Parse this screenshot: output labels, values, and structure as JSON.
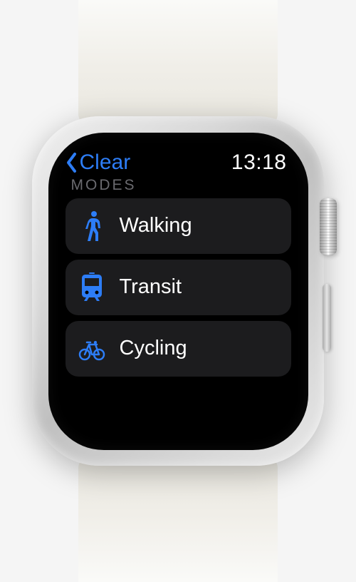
{
  "header": {
    "back_label": "Clear",
    "time": "13:18"
  },
  "section": {
    "title": "MODES"
  },
  "colors": {
    "accent": "#2d7df6",
    "row_bg": "#1c1c1e",
    "text": "#ffffff",
    "muted": "#6a6a6f"
  },
  "modes": [
    {
      "id": "walking",
      "label": "Walking",
      "icon": "walking-icon"
    },
    {
      "id": "transit",
      "label": "Transit",
      "icon": "transit-icon"
    },
    {
      "id": "cycling",
      "label": "Cycling",
      "icon": "cycling-icon"
    }
  ]
}
